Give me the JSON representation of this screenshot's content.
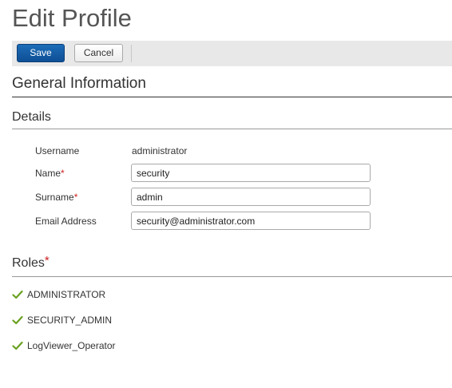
{
  "page": {
    "title": "Edit Profile"
  },
  "toolbar": {
    "save_label": "Save",
    "cancel_label": "Cancel"
  },
  "sections": {
    "general": "General Information",
    "details": "Details",
    "roles": "Roles"
  },
  "required_marker": "*",
  "details": {
    "username": {
      "label": "Username",
      "value": "administrator"
    },
    "name": {
      "label": "Name",
      "value": "security"
    },
    "surname": {
      "label": "Surname",
      "value": "admin"
    },
    "email": {
      "label": "Email Address",
      "value": "security@administrator.com"
    }
  },
  "roles": [
    {
      "label": "ADMINISTRATOR",
      "icon": "check-icon"
    },
    {
      "label": "SECURITY_ADMIN",
      "icon": "check-icon"
    },
    {
      "label": "LogViewer_Operator",
      "icon": "check-icon"
    }
  ],
  "colors": {
    "primary_button": "#0e4f95",
    "required": "#cc2222",
    "check": "#6aa121"
  }
}
